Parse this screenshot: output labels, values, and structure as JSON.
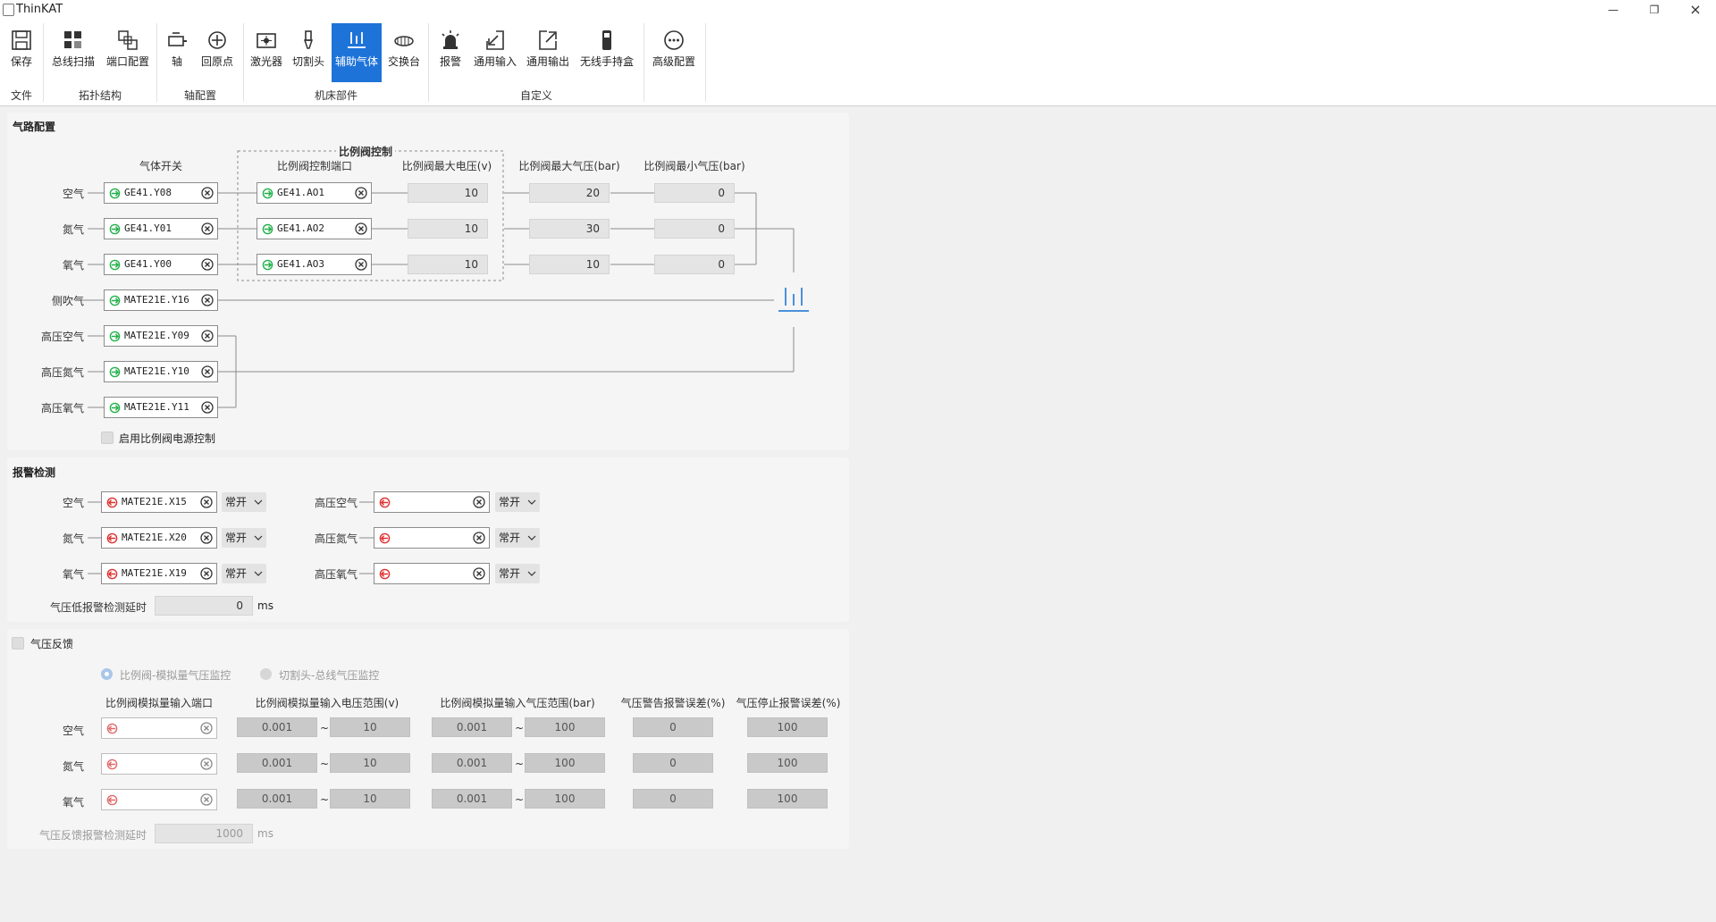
{
  "window": {
    "title": "ThinKAT"
  },
  "ribbon": {
    "buttons": [
      {
        "label": "保存",
        "icon": "save-icon"
      },
      {
        "label": "总线扫描",
        "icon": "bus-scan-icon"
      },
      {
        "label": "端口配置",
        "icon": "port-config-icon"
      },
      {
        "label": "轴",
        "icon": "axis-icon"
      },
      {
        "label": "回原点",
        "icon": "home-icon"
      },
      {
        "label": "激光器",
        "icon": "laser-icon"
      },
      {
        "label": "切割头",
        "icon": "cutting-head-icon"
      },
      {
        "label": "辅助气体",
        "icon": "gas-icon"
      },
      {
        "label": "交换台",
        "icon": "exchange-table-icon"
      },
      {
        "label": "报警",
        "icon": "alarm-icon"
      },
      {
        "label": "通用输入",
        "icon": "input-icon"
      },
      {
        "label": "通用输出",
        "icon": "output-icon"
      },
      {
        "label": "无线手持盒",
        "icon": "handheld-icon"
      },
      {
        "label": "高级配置",
        "icon": "more-icon"
      }
    ],
    "active": "辅助气体",
    "groups": [
      "文件",
      "拓扑结构",
      "轴配置",
      "机床部件",
      "自定义"
    ]
  },
  "gas": {
    "title": "气路配置",
    "headers": {
      "switch": "气体开关",
      "prop_group": "比例阀控制",
      "prop_port": "比例阀控制端口",
      "max_v": "比例阀最大电压(v)",
      "max_bar": "比例阀最大气压(bar)",
      "min_bar": "比例阀最小气压(bar)"
    },
    "rows": [
      {
        "label": "空气",
        "switch": "GE41.Y08",
        "port": "GE41.AO1",
        "max_v": "10",
        "max_bar": "20",
        "min_bar": "0"
      },
      {
        "label": "氮气",
        "switch": "GE41.Y01",
        "port": "GE41.AO2",
        "max_v": "10",
        "max_bar": "30",
        "min_bar": "0"
      },
      {
        "label": "氧气",
        "switch": "GE41.Y00",
        "port": "GE41.AO3",
        "max_v": "10",
        "max_bar": "10",
        "min_bar": "0"
      }
    ],
    "extra": [
      {
        "label": "侧吹气",
        "switch": "MATE21E.Y16"
      },
      {
        "label": "高压空气",
        "switch": "MATE21E.Y09"
      },
      {
        "label": "高压氮气",
        "switch": "MATE21E.Y10"
      },
      {
        "label": "高压氧气",
        "switch": "MATE21E.Y11"
      }
    ],
    "enable_power": "启用比例阀电源控制"
  },
  "alarm": {
    "title": "报警检测",
    "left": [
      {
        "label": "空气",
        "port": "MATE21E.X15",
        "mode": "常开"
      },
      {
        "label": "氮气",
        "port": "MATE21E.X20",
        "mode": "常开"
      },
      {
        "label": "氧气",
        "port": "MATE21E.X19",
        "mode": "常开"
      }
    ],
    "right": [
      {
        "label": "高压空气",
        "port": "",
        "mode": "常开"
      },
      {
        "label": "高压氮气",
        "port": "",
        "mode": "常开"
      },
      {
        "label": "高压氧气",
        "port": "",
        "mode": "常开"
      }
    ],
    "delay_label": "气压低报警检测延时",
    "delay_value": "0",
    "delay_unit": "ms"
  },
  "feedback": {
    "title": "气压反馈",
    "radio1": "比例阀-模拟量气压监控",
    "radio2": "切割头-总线气压监控",
    "headers": {
      "port": "比例阀模拟量输入端口",
      "v_range": "比例阀模拟量输入电压范围(v)",
      "bar_range": "比例阀模拟量输入气压范围(bar)",
      "warn": "气压警告报警误差(%)",
      "stop": "气压停止报警误差(%)"
    },
    "rows": [
      {
        "label": "空气",
        "v_min": "0.001",
        "v_max": "10",
        "bar_min": "0.001",
        "bar_max": "100",
        "warn": "0",
        "stop": "100"
      },
      {
        "label": "氮气",
        "v_min": "0.001",
        "v_max": "10",
        "bar_min": "0.001",
        "bar_max": "100",
        "warn": "0",
        "stop": "100"
      },
      {
        "label": "氧气",
        "v_min": "0.001",
        "v_max": "10",
        "bar_min": "0.001",
        "bar_max": "100",
        "warn": "0",
        "stop": "100"
      }
    ],
    "tilde": "~",
    "delay_label": "气压反馈报警检测延时",
    "delay_value": "1000",
    "delay_unit": "ms"
  }
}
